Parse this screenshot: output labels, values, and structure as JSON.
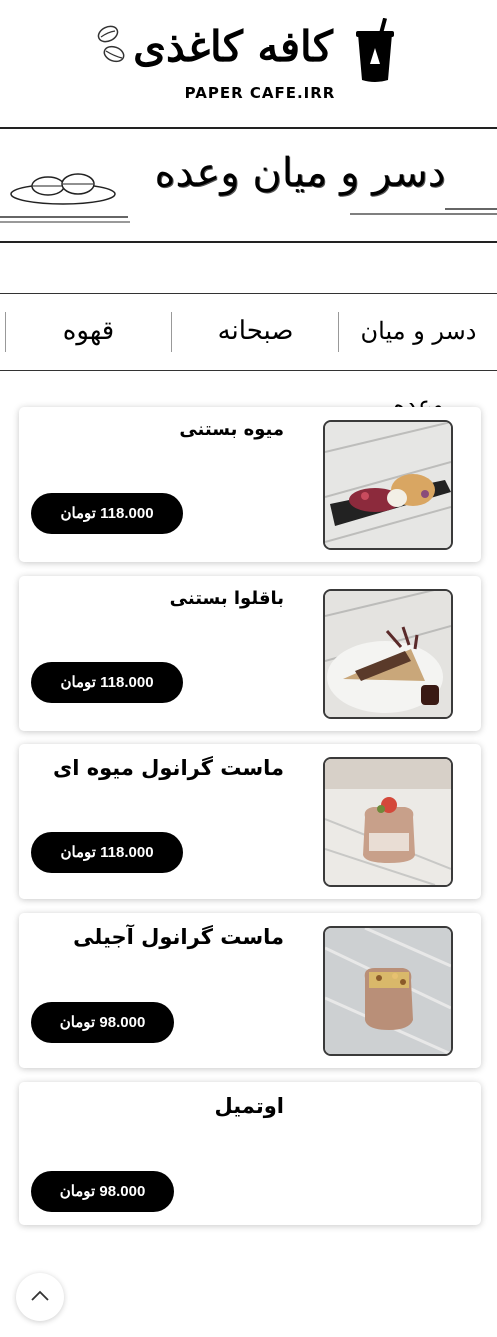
{
  "header": {
    "logo_text": "کافه کاغذی",
    "logo_subtitle": "PAPER CAFE.IRR"
  },
  "banner": {
    "title": "دسر و میان وعده"
  },
  "tabs": [
    {
      "label": "دسر و میان وعده"
    },
    {
      "label": "صبحانه"
    },
    {
      "label": "قهوه"
    }
  ],
  "items": [
    {
      "name": "میوه بستنی",
      "price": "118.000 تومان",
      "image": "fruit-ice-cream-plate"
    },
    {
      "name": "باقلوا بستنی",
      "price": "118.000 تومان",
      "image": "baklava-ice-cream-plate"
    },
    {
      "name": "ماست گرانول میوه ای",
      "price": "118.000 تومان",
      "image": "fruit-granola-yogurt-jar"
    },
    {
      "name": "ماست گرانول آجیلی",
      "price": "98.000 تومان",
      "image": "nut-granola-yogurt-jar"
    },
    {
      "name": "اوتمیل",
      "price": "98.000 تومان"
    }
  ],
  "icons": {
    "scroll_top": "chevron-up-icon"
  }
}
